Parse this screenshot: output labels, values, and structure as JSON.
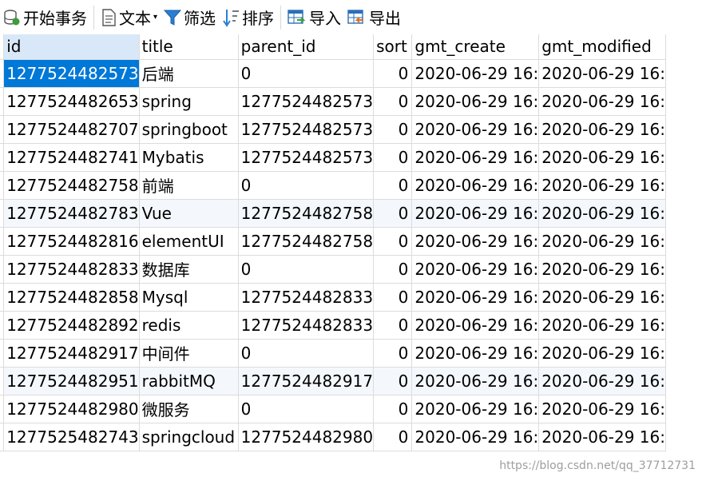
{
  "toolbar": {
    "begin_transaction": "开始事务",
    "text": "文本",
    "filter": "筛选",
    "sort": "排序",
    "import": "导入",
    "export": "导出"
  },
  "columns": [
    "id",
    "title",
    "parent_id",
    "sort",
    "gmt_create",
    "gmt_modified"
  ],
  "rows": [
    [
      "1277524482573",
      "后端",
      "0",
      "0",
      "2020-06-29 16:",
      "2020-06-29 16:"
    ],
    [
      "1277524482653",
      "spring",
      "1277524482573",
      "0",
      "2020-06-29 16:",
      "2020-06-29 16:"
    ],
    [
      "1277524482707",
      "springboot",
      "1277524482573",
      "0",
      "2020-06-29 16:",
      "2020-06-29 16:"
    ],
    [
      "1277524482741",
      "Mybatis",
      "1277524482573",
      "0",
      "2020-06-29 16:",
      "2020-06-29 16:"
    ],
    [
      "1277524482758",
      "前端",
      "0",
      "0",
      "2020-06-29 16:",
      "2020-06-29 16:"
    ],
    [
      "1277524482783",
      "Vue",
      "1277524482758",
      "0",
      "2020-06-29 16:",
      "2020-06-29 16:"
    ],
    [
      "1277524482816",
      "elementUI",
      "1277524482758",
      "0",
      "2020-06-29 16:",
      "2020-06-29 16:"
    ],
    [
      "1277524482833",
      "数据库",
      "0",
      "0",
      "2020-06-29 16:",
      "2020-06-29 16:"
    ],
    [
      "1277524482858",
      "Mysql",
      "1277524482833",
      "0",
      "2020-06-29 16:",
      "2020-06-29 16:"
    ],
    [
      "1277524482892",
      "redis",
      "1277524482833",
      "0",
      "2020-06-29 16:",
      "2020-06-29 16:"
    ],
    [
      "1277524482917",
      "中间件",
      "0",
      "0",
      "2020-06-29 16:",
      "2020-06-29 16:"
    ],
    [
      "1277524482951",
      "rabbitMQ",
      "1277524482917",
      "0",
      "2020-06-29 16:",
      "2020-06-29 16:"
    ],
    [
      "1277524482980",
      "微服务",
      "0",
      "0",
      "2020-06-29 16:",
      "2020-06-29 16:"
    ],
    [
      "1277525482743",
      "springcloud",
      "1277524482980",
      "0",
      "2020-06-29 16:",
      "2020-06-29 16:"
    ]
  ],
  "watermark": "https://blog.csdn.net/qq_37712731"
}
